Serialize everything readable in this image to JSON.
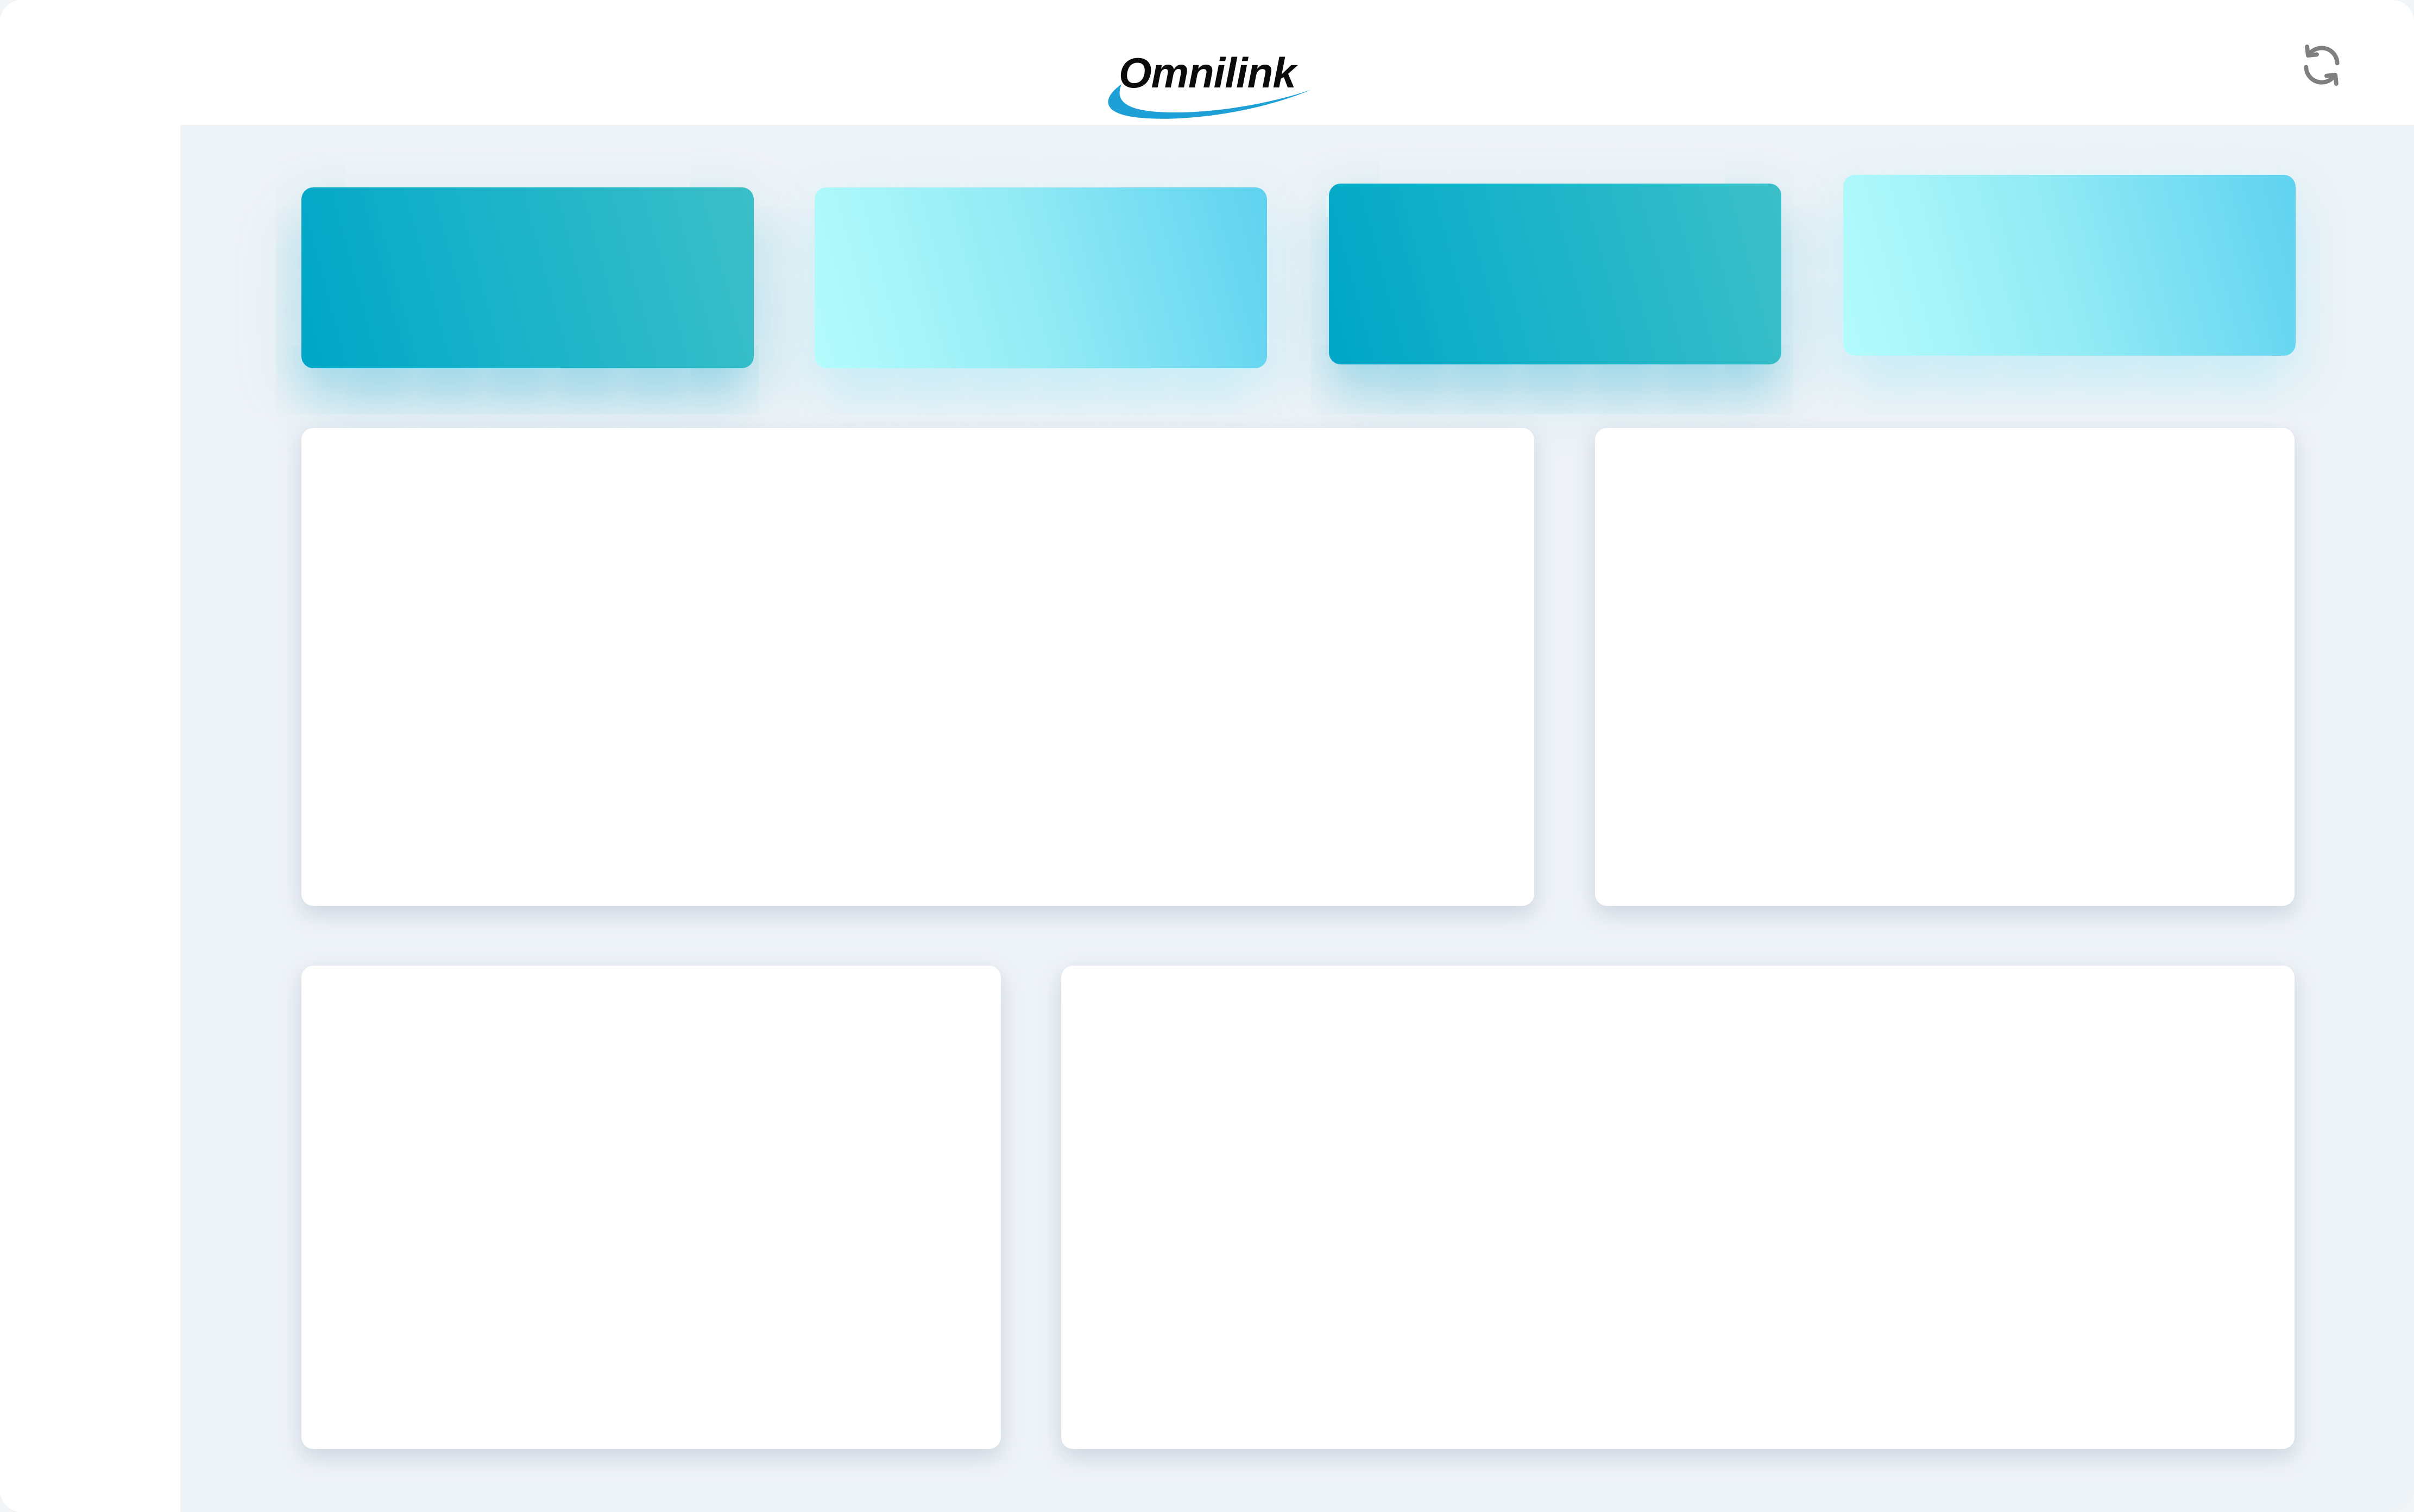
{
  "header": {
    "logo_text": "Omnilink"
  },
  "icons": {
    "refresh": "refresh-icon"
  },
  "colors": {
    "accent_dark": "#00a6c8",
    "accent_light": "#95ecf5",
    "logo_swoosh": "#1ea0d6",
    "background": "#eef3f7"
  },
  "kpi_cards": [
    "",
    "",
    "",
    ""
  ],
  "panels": [
    "",
    "",
    "",
    ""
  ]
}
